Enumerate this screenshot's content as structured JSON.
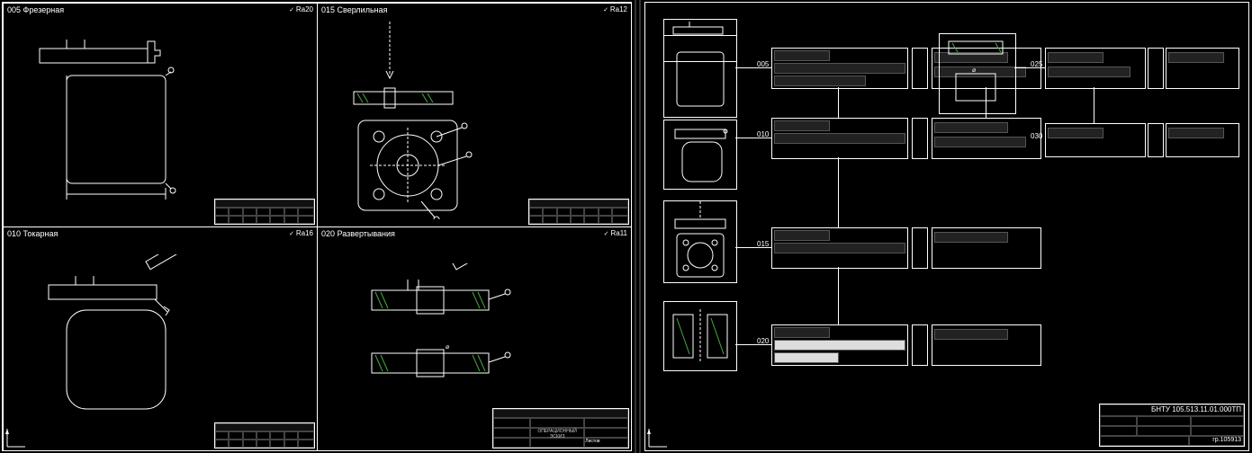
{
  "sheets": {
    "left": {
      "quads": {
        "tl": {
          "code": "005",
          "title": "Фрезерная",
          "ra": "Ra20"
        },
        "tr": {
          "code": "015",
          "title": "Сверлильная",
          "ra": "Ra12"
        },
        "bl": {
          "code": "010",
          "title": "Токарная",
          "ra": "Ra16"
        },
        "br": {
          "code": "020",
          "title": "Развертывания",
          "ra": "Ra11"
        }
      },
      "titleblock_main": "ОПЕРАЦИОННЫЙ ЭСКИЗ",
      "titleblock_sub": "Листов"
    },
    "right": {
      "header_code": "БНТУ 105.513.11.01.000ТП",
      "footer_code": "гр.105913",
      "flow_ops": [
        "005",
        "010",
        "015",
        "020",
        "025",
        "030"
      ]
    }
  }
}
